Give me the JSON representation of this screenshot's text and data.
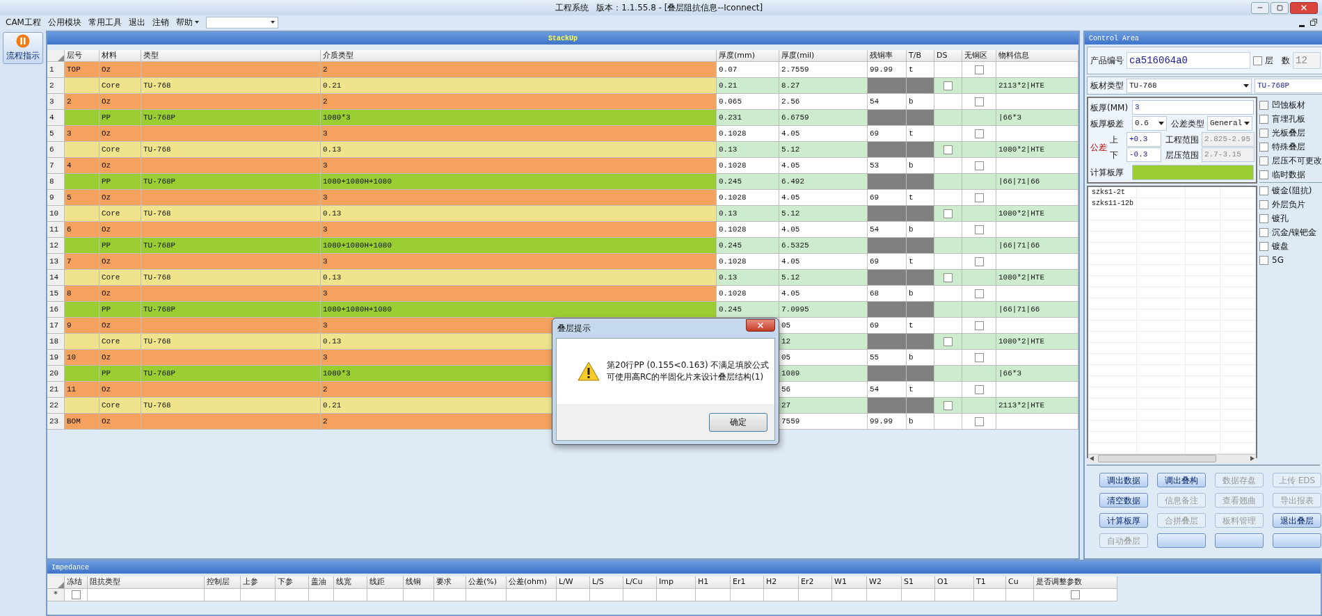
{
  "window": {
    "title": "工程系统   版本：1.1.55.8 - [叠层阻抗信息--Iconnect]"
  },
  "menu": [
    {
      "label": "CAM工程",
      "caret": false
    },
    {
      "label": "公用模块",
      "caret": false
    },
    {
      "label": "常用工具",
      "caret": false
    },
    {
      "label": "退出",
      "caret": false
    },
    {
      "label": "注销",
      "caret": false
    },
    {
      "label": "帮助",
      "caret": true
    }
  ],
  "sidebar": {
    "button": "流程指示"
  },
  "stackup": {
    "title": "StackUp",
    "columns": [
      "层号",
      "材料",
      "类型",
      "介质类型",
      "厚度(mm)",
      "厚度(mil)",
      "残铜率",
      "T/B",
      "DS",
      "无铜区",
      "物料信息"
    ],
    "rows": [
      {
        "number": "1",
        "kind": "oz",
        "layer": "TOP",
        "material": "Oz",
        "dielectric": "2",
        "thickness_mm": "0.07",
        "thickness_mil": "2.7559",
        "residual_copper": "99.99",
        "tb": "t",
        "no_copper": {
          "checked": false
        }
      },
      {
        "number": "2",
        "kind": "core",
        "material": "Core",
        "type": "TU-768",
        "dielectric": "0.21",
        "thickness_mm": "0.21",
        "thickness_mil": "8.27",
        "ds": {
          "checked": false
        },
        "material_info": "2113*2|HTE"
      },
      {
        "number": "3",
        "kind": "oz",
        "layer": "2",
        "material": "Oz",
        "dielectric": "2",
        "thickness_mm": "0.065",
        "thickness_mil": "2.56",
        "residual_copper": "54",
        "tb": "b",
        "no_copper": {
          "checked": false
        }
      },
      {
        "number": "4",
        "kind": "pp",
        "material": "PP",
        "type": "TU-768P",
        "dielectric": "1080*3",
        "thickness_mm": "0.231",
        "thickness_mil": "6.6759",
        "material_info": "|66*3"
      },
      {
        "number": "5",
        "kind": "oz",
        "layer": "3",
        "material": "Oz",
        "dielectric": "3",
        "thickness_mm": "0.1028",
        "thickness_mil": "4.05",
        "residual_copper": "69",
        "tb": "t",
        "no_copper": {
          "checked": false
        }
      },
      {
        "number": "6",
        "kind": "core",
        "material": "Core",
        "type": "TU-768",
        "dielectric": "0.13",
        "thickness_mm": "0.13",
        "thickness_mil": "5.12",
        "ds": {
          "checked": false
        },
        "material_info": "1080*2|HTE"
      },
      {
        "number": "7",
        "kind": "oz",
        "layer": "4",
        "material": "Oz",
        "dielectric": "3",
        "thickness_mm": "0.1028",
        "thickness_mil": "4.05",
        "residual_copper": "53",
        "tb": "b",
        "no_copper": {
          "checked": false
        }
      },
      {
        "number": "8",
        "kind": "pp",
        "material": "PP",
        "type": "TU-768P",
        "dielectric": "1080+1080H+1080",
        "thickness_mm": "0.245",
        "thickness_mil": "6.492",
        "material_info": "|66|71|66"
      },
      {
        "number": "9",
        "kind": "oz",
        "layer": "5",
        "material": "Oz",
        "dielectric": "3",
        "thickness_mm": "0.1028",
        "thickness_mil": "4.05",
        "residual_copper": "69",
        "tb": "t",
        "no_copper": {
          "checked": false
        }
      },
      {
        "number": "10",
        "kind": "core",
        "material": "Core",
        "type": "TU-768",
        "dielectric": "0.13",
        "thickness_mm": "0.13",
        "thickness_mil": "5.12",
        "ds": {
          "checked": false
        },
        "material_info": "1080*2|HTE"
      },
      {
        "number": "11",
        "kind": "oz",
        "layer": "6",
        "material": "Oz",
        "dielectric": "3",
        "thickness_mm": "0.1028",
        "thickness_mil": "4.05",
        "residual_copper": "54",
        "tb": "b",
        "no_copper": {
          "checked": false
        }
      },
      {
        "number": "12",
        "kind": "pp",
        "material": "PP",
        "type": "TU-768P",
        "dielectric": "1080+1080H+1080",
        "thickness_mm": "0.245",
        "thickness_mil": "6.5325",
        "material_info": "|66|71|66"
      },
      {
        "number": "13",
        "kind": "oz",
        "layer": "7",
        "material": "Oz",
        "dielectric": "3",
        "thickness_mm": "0.1028",
        "thickness_mil": "4.05",
        "residual_copper": "69",
        "tb": "t",
        "no_copper": {
          "checked": false
        }
      },
      {
        "number": "14",
        "kind": "core",
        "material": "Core",
        "type": "TU-768",
        "dielectric": "0.13",
        "thickness_mm": "0.13",
        "thickness_mil": "5.12",
        "ds": {
          "checked": false
        },
        "material_info": "1080*2|HTE"
      },
      {
        "number": "15",
        "kind": "oz",
        "layer": "8",
        "material": "Oz",
        "dielectric": "3",
        "thickness_mm": "0.1028",
        "thickness_mil": "4.05",
        "residual_copper": "68",
        "tb": "b",
        "no_copper": {
          "checked": false
        }
      },
      {
        "number": "16",
        "kind": "pp",
        "material": "PP",
        "type": "TU-768P",
        "dielectric": "1080+1080H+1080",
        "thickness_mm": "0.245",
        "thickness_mil": "7.0995",
        "material_info": "|66|71|66"
      },
      {
        "number": "17",
        "kind": "oz",
        "layer": "9",
        "material": "Oz",
        "dielectric": "3",
        "thickness_mil": "05",
        "residual_copper": "69",
        "tb": "t",
        "no_copper": {
          "checked": false
        }
      },
      {
        "number": "18",
        "kind": "core",
        "material": "Core",
        "type": "TU-768",
        "dielectric": "0.13",
        "thickness_mil": "12",
        "ds": {
          "checked": false
        },
        "material_info": "1080*2|HTE"
      },
      {
        "number": "19",
        "kind": "oz",
        "layer": "10",
        "material": "Oz",
        "dielectric": "3",
        "thickness_mil": "05",
        "residual_copper": "55",
        "tb": "b",
        "no_copper": {
          "checked": false
        }
      },
      {
        "number": "20",
        "kind": "pp",
        "material": "PP",
        "type": "TU-768P",
        "dielectric": "1080*3",
        "thickness_mil": "1089",
        "material_info": "|66*3"
      },
      {
        "number": "21",
        "kind": "oz",
        "layer": "11",
        "material": "Oz",
        "dielectric": "2",
        "thickness_mil": "56",
        "residual_copper": "54",
        "tb": "t",
        "no_copper": {
          "checked": false
        }
      },
      {
        "number": "22",
        "kind": "core",
        "material": "Core",
        "type": "TU-768",
        "dielectric": "0.21",
        "thickness_mil": "27",
        "ds": {
          "checked": false
        },
        "material_info": "2113*2|HTE"
      },
      {
        "number": "23",
        "kind": "oz",
        "layer": "BOM",
        "material": "Oz",
        "dielectric": "2",
        "thickness_mil": "7559",
        "residual_copper": "99.99",
        "tb": "b",
        "no_copper": {
          "checked": false
        }
      }
    ]
  },
  "dialog": {
    "title": "叠层提示",
    "lines": [
      "第20行PP (0.155<0.163) 不满足填胶公式",
      "可使用高RC的半固化片来设计叠层结构(1)"
    ],
    "button": "确定"
  },
  "control_area": {
    "title": "Control Area",
    "product_code": {
      "label": "产品编号",
      "value": "ca516064a0"
    },
    "layer_count": {
      "label_1": "层",
      "label_2": "数",
      "checked": false,
      "value": "12",
      "disabled": true
    },
    "board_material": {
      "label": "板材类型",
      "value": "TU-768",
      "pp_value": "TU-768P"
    },
    "thickness": {
      "label": "板厚(MM)",
      "value": "3"
    },
    "thickness_range": {
      "label": "板厚极差",
      "value": "0.6"
    },
    "tolerance_type": {
      "label": "公差类型",
      "value": "General"
    },
    "tolerance": {
      "label": "公差",
      "upper_label": "上",
      "upper": "+0.3",
      "lower_label": "下",
      "lower": "-0.3"
    },
    "engineering_range": {
      "label": "工程范围",
      "value": "2.825-2.95",
      "disabled": true
    },
    "lamination_range": {
      "label": "层压范围",
      "value": "2.7-3.15",
      "disabled": true
    },
    "calc_thickness": {
      "label": "计算板厚"
    },
    "options": [
      {
        "label": "凹蚀板材",
        "checked": false
      },
      {
        "label": "盲埋孔板",
        "checked": false
      },
      {
        "label": "光板叠层",
        "checked": false
      },
      {
        "label": "特殊叠层",
        "checked": false
      },
      {
        "label": "层压不可更改",
        "checked": false
      },
      {
        "label": "临时数据",
        "checked": false
      }
    ],
    "options_2": [
      {
        "label": "镀金(阻抗)",
        "checked": false
      },
      {
        "label": "外层负片",
        "checked": false
      },
      {
        "label": "镀孔",
        "checked": false
      },
      {
        "label": "沉金/镍钯金",
        "checked": false
      },
      {
        "label": "镀盘",
        "checked": false
      },
      {
        "label": "5G",
        "checked": false
      }
    ],
    "list": [
      "szks1-2t",
      "szks11-12b"
    ],
    "buttons": [
      {
        "label": "调出数据",
        "disabled": false
      },
      {
        "label": "调出叠构",
        "disabled": false
      },
      {
        "label": "数据存盘",
        "disabled": true
      },
      {
        "label": "上传 EDS",
        "disabled": true
      },
      {
        "label": "清空数据",
        "disabled": false
      },
      {
        "label": "信息备注",
        "disabled": true
      },
      {
        "label": "查看翘曲",
        "disabled": true
      },
      {
        "label": "导出报表",
        "disabled": true
      },
      {
        "label": "计算板厚",
        "disabled": false
      },
      {
        "label": "合拼叠层",
        "disabled": true
      },
      {
        "label": "板料管理",
        "disabled": true
      },
      {
        "label": "退出叠层",
        "disabled": false
      },
      {
        "label": "自动叠层",
        "disabled": true
      },
      {
        "disabled": false
      },
      {
        "disabled": false
      },
      {
        "disabled": false
      }
    ]
  },
  "impedance": {
    "title": "Impedance",
    "columns": [
      "冻结",
      "阻抗类型",
      "控制层",
      "上参",
      "下参",
      "盖油",
      "线宽",
      "线距",
      "线铜",
      "要求",
      "公差(%)",
      "公差(ohm)",
      "L/W",
      "L/S",
      "L/Cu",
      "Imp",
      "H1",
      "Er1",
      "H2",
      "Er2",
      "W1",
      "W2",
      "S1",
      "O1",
      "T1",
      "Cu",
      "是否调整参数"
    ],
    "new_row": {
      "marker": "*",
      "frozen": {
        "checked": false
      },
      "adjust": {
        "checked": false
      }
    }
  }
}
